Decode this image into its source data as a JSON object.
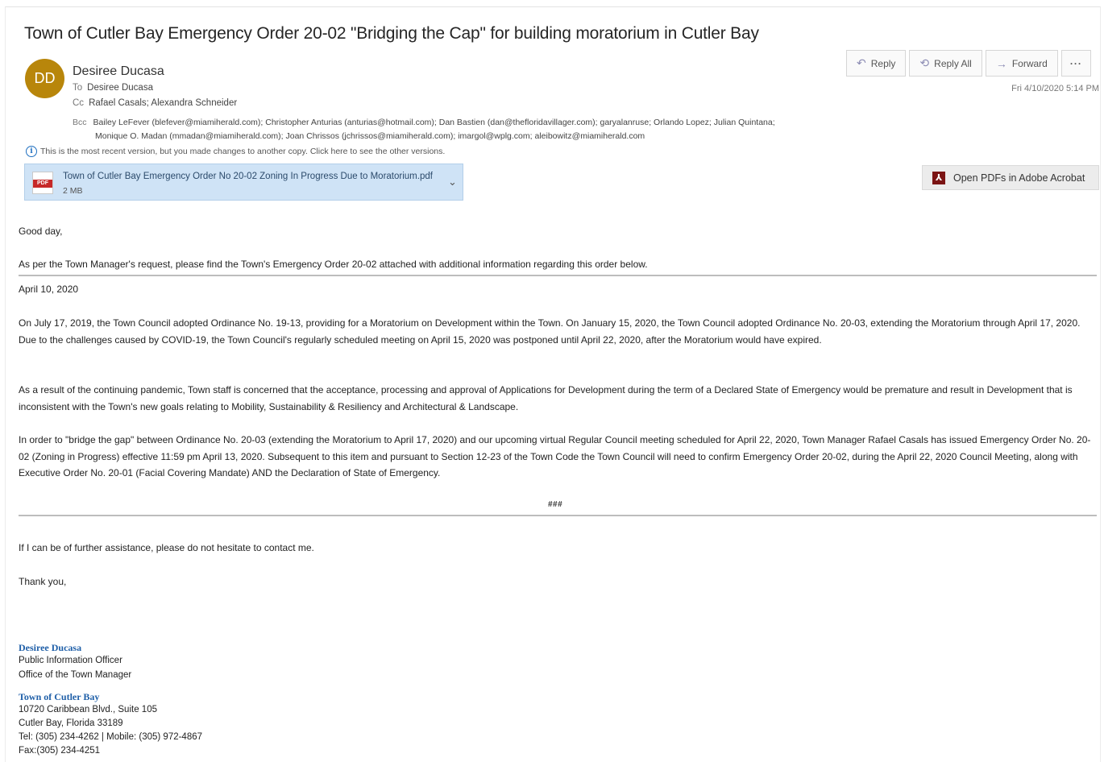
{
  "subject": "Town of Cutler Bay Emergency Order 20-02 \"Bridging the Cap\" for building moratorium in Cutler Bay",
  "sender": {
    "initials": "DD",
    "avatar_color": "#b8860b",
    "name": "Desiree Ducasa"
  },
  "recipients": {
    "to_label": "To",
    "to": "Desiree Ducasa",
    "cc_label": "Cc",
    "cc": "Rafael Casals; Alexandra Schneider",
    "bcc_label": "Bcc",
    "bcc_line1": "Bailey LeFever (blefever@miamiherald.com); Christopher Anturias (anturias@hotmail.com); Dan Bastien (dan@thefloridavillager.com); garyalanruse; Orlando Lopez; Julian Quintana;",
    "bcc_line2": "Monique O. Madan (mmadan@miamiherald.com); Joan Chrissos (jchrissos@miamiherald.com); imargol@wplg.com; aleibowitz@miamiherald.com"
  },
  "info_notice": "This is the most recent version, but you made changes to another copy. Click here to see the other versions.",
  "attachment": {
    "badge": "PDF",
    "name": "Town of Cutler Bay Emergency Order No 20-02 Zoning In Progress Due to Moratorium.pdf",
    "size": "2 MB"
  },
  "actions": {
    "reply": "Reply",
    "reply_all": "Reply All",
    "forward": "Forward",
    "more": "···"
  },
  "date": "Fri 4/10/2020 5:14 PM",
  "acrobat": {
    "label": "Open PDFs in Adobe Acrobat"
  },
  "body": {
    "greeting": "Good day,",
    "intro": "As per the Town Manager's request, please find the Town's Emergency Order 20-02 attached with additional information regarding this order below.",
    "date_line": "April 10, 2020",
    "para1": "On July 17, 2019, the Town Council adopted Ordinance No. 19-13, providing for a Moratorium on Development within the Town. On January 15, 2020, the Town Council adopted Ordinance No. 20-03, extending the Moratorium through April 17, 2020.  Due to the challenges caused by COVID-19, the Town Council's regularly scheduled meeting on April 15, 2020 was postponed until April 22, 2020, after the Moratorium would have expired.",
    "para2": "As a result of the continuing pandemic, Town staff is concerned that the acceptance, processing and approval of Applications for Development during the term of a Declared State of Emergency would be premature and result in Development that is inconsistent with the Town's new goals relating to Mobility, Sustainability & Resiliency and Architectural & Landscape.",
    "para3": "In order to \"bridge the gap\" between Ordinance No. 20-03 (extending the Moratorium to April 17, 2020) and our upcoming virtual Regular Council meeting scheduled for April 22, 2020, Town Manager Rafael Casals has issued Emergency Order No. 20-02 (Zoning in Progress) effective 11:59 pm April 13, 2020.  Subsequent to this item and pursuant to Section 12-23 of the Town Code the Town Council will need to confirm Emergency Order 20-02, during the April 22, 2020 Council Meeting, along with Executive Order No. 20-01 (Facial Covering Mandate) AND the Declaration of State of Emergency.",
    "hashes": "###",
    "closing1": "If I can be of further assistance, please do not hesitate to contact me.",
    "closing2": "Thank you,"
  },
  "signature": {
    "name": "Desiree Ducasa",
    "title": "Public Information Officer",
    "office": "Office of the Town Manager",
    "org": "Town of Cutler Bay",
    "address1": "10720 Caribbean Blvd., Suite 105",
    "address2": "Cutler Bay, Florida 33189",
    "phone": "Tel: (305) 234-4262 | Mobile: (305) 972-4867",
    "fax": "Fax:(305) 234-4251"
  }
}
